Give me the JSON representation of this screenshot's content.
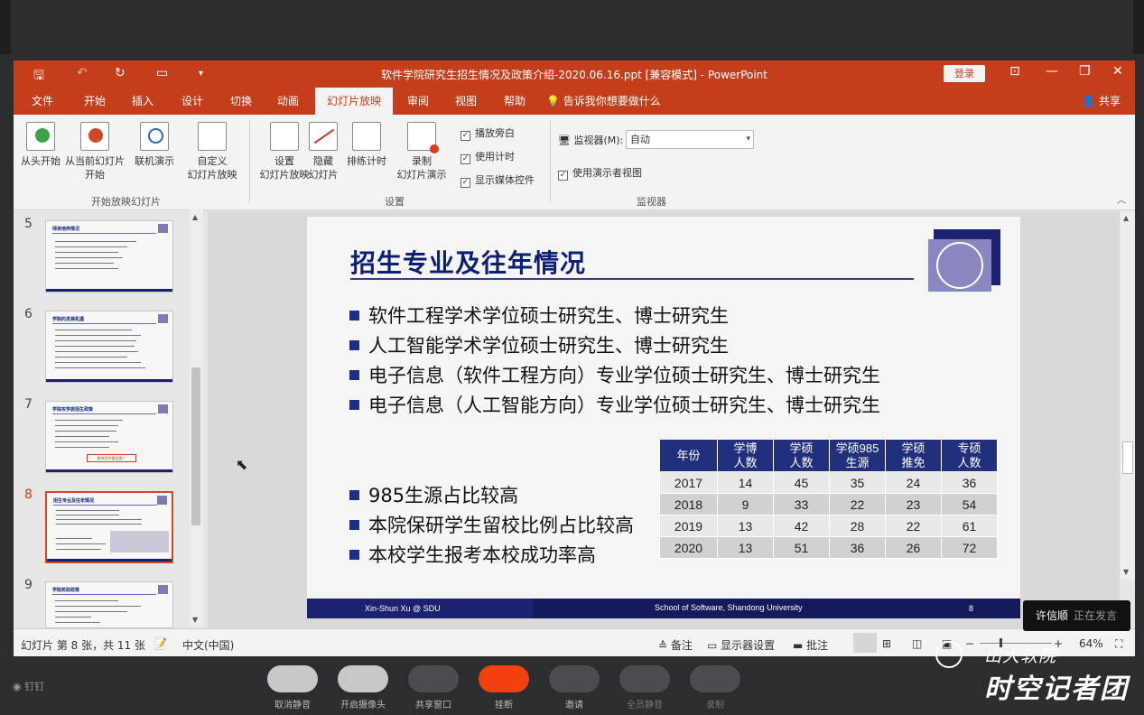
{
  "window": {
    "title": "软件学院研究生招生情况及政策介绍-2020.06.16.ppt [兼容模式] - PowerPoint",
    "login_label": "登录"
  },
  "ribbon_tabs": [
    "文件",
    "开始",
    "插入",
    "设计",
    "切换",
    "动画",
    "幻灯片放映",
    "审阅",
    "视图",
    "帮助"
  ],
  "active_tab": "幻灯片放映",
  "tell_me": "告诉我你想要做什么",
  "share_label": "共享",
  "ribbon": {
    "start_group": {
      "label": "开始放映幻灯片",
      "from_beginning": "从头开始",
      "from_current_1": "从当前幻灯片",
      "from_current_2": "开始",
      "online": "联机演示",
      "custom_1": "自定义",
      "custom_2": "幻灯片放映"
    },
    "setup_group": {
      "label": "设置",
      "setup_1": "设置",
      "setup_2": "幻灯片放映",
      "hide_1": "隐藏",
      "hide_2": "幻灯片",
      "rehearse": "排练计时",
      "record_1": "录制",
      "record_2": "幻灯片演示",
      "play_narrations": "播放旁白",
      "use_timings": "使用计时",
      "show_media": "显示媒体控件"
    },
    "monitor_group": {
      "label": "监视器",
      "monitor_label": "监视器(M):",
      "monitor_value": "自动",
      "presenter_view": "使用演示者视图"
    }
  },
  "thumbnails": [
    {
      "num": "5",
      "title": "师资培养情况"
    },
    {
      "num": "6",
      "title": "学院的发展机遇"
    },
    {
      "num": "7",
      "title": "学院攻学质招生政策",
      "badge": "报考条件看这里！"
    },
    {
      "num": "8",
      "title": "招生专业及往年情况"
    },
    {
      "num": "9",
      "title": "学院奖助政策"
    }
  ],
  "slide": {
    "title": "招生专业及往年情况",
    "majors": [
      "软件工程学术学位硕士研究生、博士研究生",
      "人工智能学术学位硕士研究生、博士研究生",
      "电子信息（软件工程方向）专业学位硕士研究生、博士研究生",
      "电子信息（人工智能方向）专业学位硕士研究生、博士研究生"
    ],
    "points": [
      "985生源占比较高",
      "本院保研学生留校比例占比较高",
      "本校学生报考本校成功率高"
    ],
    "table": {
      "headers": [
        [
          "年份"
        ],
        [
          "学博",
          "人数"
        ],
        [
          "学硕",
          "人数"
        ],
        [
          "学硕985",
          "生源"
        ],
        [
          "学硕",
          "推免"
        ],
        [
          "专硕",
          "人数"
        ]
      ],
      "rows": [
        [
          "2017",
          "14",
          "45",
          "35",
          "24",
          "36"
        ],
        [
          "2018",
          "9",
          "33",
          "22",
          "23",
          "54"
        ],
        [
          "2019",
          "13",
          "42",
          "28",
          "22",
          "61"
        ],
        [
          "2020",
          "13",
          "51",
          "36",
          "26",
          "72"
        ]
      ]
    },
    "footer_left": "Xin-Shun Xu @ SDU",
    "footer_center": "School of Software, Shandong University",
    "page_num": "8"
  },
  "status": {
    "slide_info": "幻灯片 第 8 张，共 11 张",
    "language": "中文(中国)",
    "notes": "备注",
    "display_settings": "显示器设置",
    "comments": "批注",
    "zoom": "64%"
  },
  "speaker_toast": {
    "name": "许信顺",
    "status": "正在发言"
  },
  "meeting": {
    "app_name": "钉钉",
    "buttons": [
      "取消静音",
      "开启摄像头",
      "共享窗口",
      "挂断",
      "邀请",
      "全员静音",
      "录制"
    ]
  },
  "watermark": {
    "line1": "山大软院",
    "line2": "时空记者团"
  }
}
